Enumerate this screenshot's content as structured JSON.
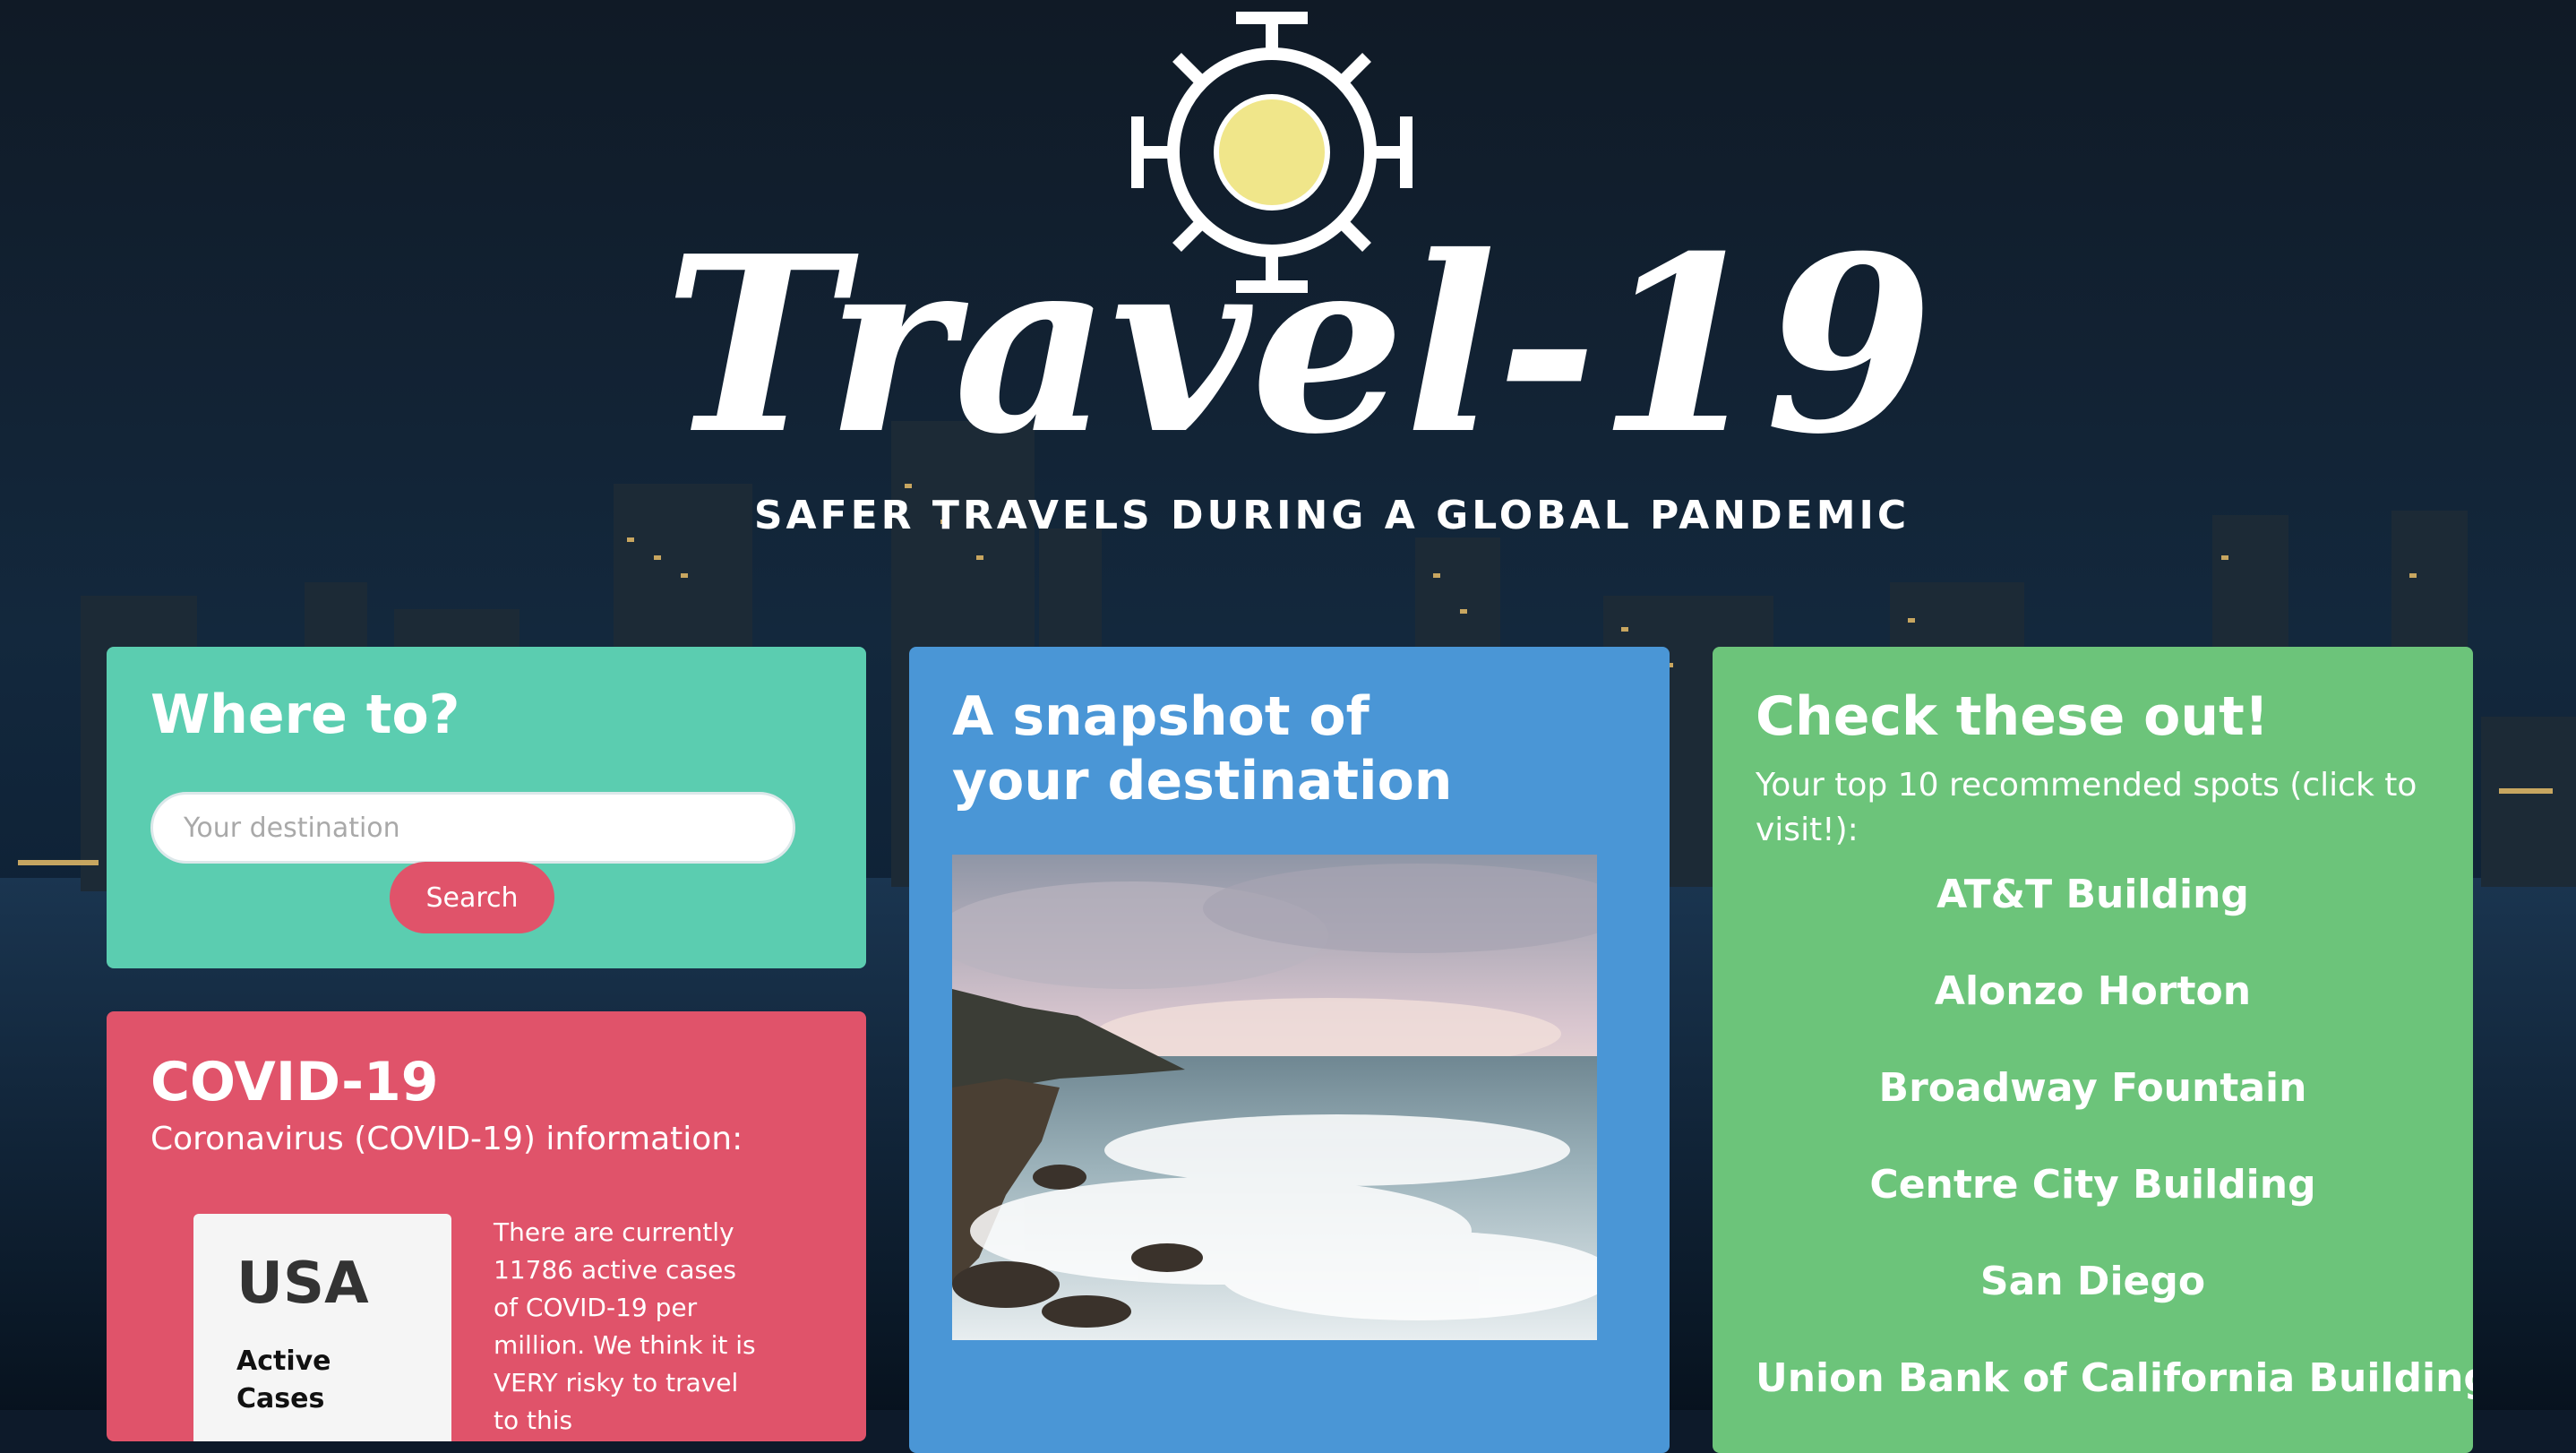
{
  "brand": {
    "logo_title": "Travel-19",
    "tagline": "SAFER TRAVELS DURING A GLOBAL PANDEMIC"
  },
  "search_card": {
    "heading": "Where to?",
    "placeholder": "Your destination",
    "button_label": "Search",
    "color": "#5bcdb0"
  },
  "covid_card": {
    "heading": "COVID-19",
    "subheading": "Coronavirus (COVID-19) information:",
    "country": "USA",
    "active_label": "Active Cases",
    "risk_text": "There are currently 11786 active cases of COVID-19 per million. We think it is VERY risky to travel to this",
    "color": "#e0536a"
  },
  "snapshot_card": {
    "heading": "A snapshot of your destination",
    "image_icon": "coastal-seascape-photo",
    "color": "#4a96d6"
  },
  "recommendations_card": {
    "heading": "Check these out!",
    "intro": "Your top 10 recommended spots (click to visit!):",
    "items": [
      {
        "label": "AT&T Building"
      },
      {
        "label": "Alonzo Horton"
      },
      {
        "label": "Broadway Fountain"
      },
      {
        "label": "Centre City Building"
      },
      {
        "label": "San Diego"
      },
      {
        "label": "Union Bank of California Building"
      }
    ],
    "color": "#6cc47a"
  }
}
